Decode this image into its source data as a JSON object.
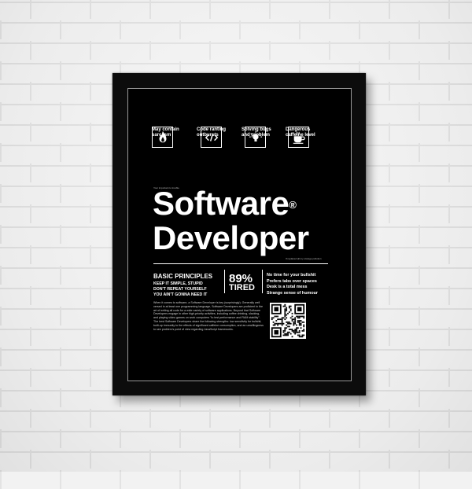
{
  "poster": {
    "icons": [
      {
        "icon": "flame-icon",
        "caption": "May contain\nsarcasm"
      },
      {
        "icon": "code-icon",
        "caption": "Code ranting\noutbursts"
      },
      {
        "icon": "lightbulb-icon",
        "caption": "Solving bugs\nand problem"
      },
      {
        "icon": "coffee-cup-icon",
        "caption": "Dangerous\ncaffeine level"
      }
    ],
    "small_left": "Your important to trouble",
    "title_line1": "Software",
    "title_line2": "Developer",
    "registered": "®",
    "small_right": "If replaced all my storage pollution",
    "basic_principles": {
      "heading": "BASIC PRINCIPLES",
      "items": [
        "KEEP IT SIMPLE, STUPID",
        "DON'T REPEAT YOURSELF",
        "YOU AIN'T GONNA NEED IT"
      ]
    },
    "stat": {
      "value": "89%",
      "label": "TIRED"
    },
    "facts": [
      "No time for your bullshit",
      "Prefers tabs over spaces",
      "Desk is a total mess",
      "Strange sense of humour"
    ],
    "description": "When it comes to software, a Software Developer is key (surprisingly). Generally well versed in at least one programming language, Software Developers are proficient in the art of writing all code for a wide variety of software applications. Beyond that Software Developers engage in other high-priority activities, including coffee drinking, slacking, and playing video games on work computers \"to test performance and RAM stability\". The best Software Developers share the following strengths: low sensitivity for bullshit, built-up immunity to the effects of significant caffeine consumption, and an unwillingness to see problem's point of view regarding JavaScript frameworks."
  },
  "colors": {
    "poster_bg": "#000000",
    "frame": "#0c0c0c",
    "wall": "#f4f4f4",
    "text": "#ffffff"
  }
}
